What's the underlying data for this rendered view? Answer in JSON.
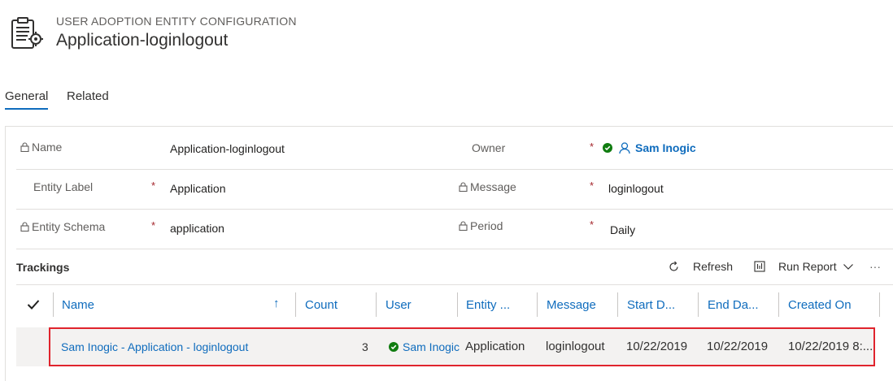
{
  "header": {
    "entity_type": "USER ADOPTION ENTITY CONFIGURATION",
    "record_title": "Application-loginlogout",
    "icon": "form-document-icon"
  },
  "tabs": [
    {
      "label": "General",
      "active": true
    },
    {
      "label": "Related",
      "active": false
    }
  ],
  "fields": {
    "name": {
      "label": "Name",
      "value": "Application-loginlogout",
      "locked": true,
      "required": false
    },
    "entity_label": {
      "label": "Entity Label",
      "value": "Application",
      "locked": false,
      "required": true
    },
    "entity_schema": {
      "label": "Entity Schema",
      "value": "application",
      "locked": true,
      "required": true
    },
    "owner": {
      "label": "Owner",
      "value": "Sam Inogic",
      "required": true
    },
    "message": {
      "label": "Message",
      "value": "loginlogout",
      "locked": true,
      "required": true
    },
    "period": {
      "label": "Period",
      "value": "Daily",
      "locked": true,
      "required": true
    }
  },
  "required_marker": "*",
  "trackings": {
    "title": "Trackings",
    "toolbar": {
      "refresh_label": "Refresh",
      "run_report_label": "Run Report",
      "more_label": "···"
    },
    "columns": [
      "Name",
      "Count",
      "User",
      "Entity ...",
      "Message",
      "Start D...",
      "End Da...",
      "Created On"
    ],
    "sort_indicator": "↑",
    "rows": [
      {
        "name": "Sam Inogic - Application - loginlogout",
        "count": "3",
        "user": "Sam Inogic",
        "entity": "Application",
        "message": "loginlogout",
        "start_date": "10/22/2019",
        "end_date": "10/22/2019",
        "created_on": "10/22/2019 8:..."
      }
    ]
  },
  "colors": {
    "accent": "#0f6cbd",
    "required": "#a4262c",
    "status_ok": "#107c10",
    "highlight_border": "#e0242d"
  }
}
